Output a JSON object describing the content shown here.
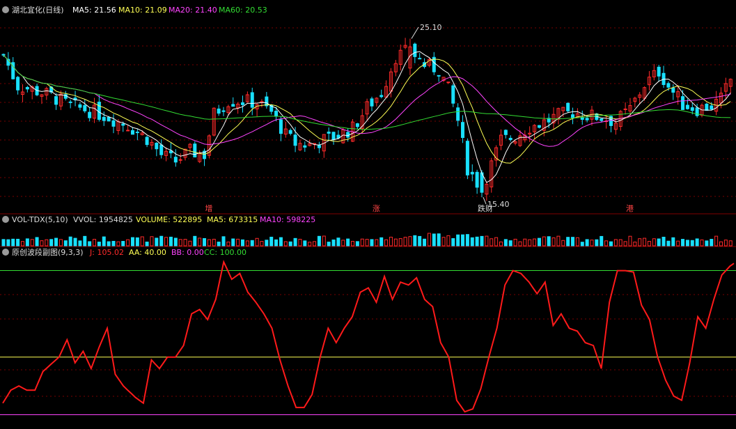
{
  "colors": {
    "bg": "#000000",
    "up": "#ff2a2a",
    "down": "#19e0ff",
    "grid": "#7a0000",
    "ma5": "#ffffff",
    "ma10": "#ffff55",
    "ma20": "#ff44ff",
    "ma60": "#33dd33",
    "osc": "#ff1a1a",
    "aa": "#ffff55",
    "bb": "#ff44ff",
    "cc": "#33dd33"
  },
  "icons": {
    "panel_toggle": "circle-chevron-down-icon"
  },
  "main": {
    "stock": "湖北宜化",
    "period": "(日线)",
    "ma5": "MA5: 21.56",
    "ma10": "MA10: 21.09",
    "ma20": "MA20: 21.40",
    "ma60": "MA60: 20.53",
    "high_label": "25.10",
    "low_label": "15.40",
    "markers": [
      {
        "text": "增",
        "index": 43
      },
      {
        "text": "涨",
        "index": 78
      },
      {
        "text": "跌财",
        "index": 100
      },
      {
        "text": "港",
        "index": 131
      }
    ]
  },
  "vol": {
    "name": "VOL-TDX(5,10)",
    "vvol": "VVOL: 1954825",
    "volume": "VOLUME: 522895",
    "ma5": "MA5: 673315",
    "ma10": "MA10: 598225"
  },
  "osc": {
    "name": "原创波段副图(9,3,3)",
    "j": "J: 105.02",
    "aa": "AA: 40.00",
    "bb": "BB: 0.00",
    "cc": "CC: 100.00"
  },
  "chart_data": {
    "type": "candlestick",
    "price_range": [
      14.6,
      26.4
    ],
    "candles": [],
    "j_range": [
      -8,
      108
    ],
    "j_values": [],
    "aa": 40,
    "bb": 0,
    "cc": 100
  }
}
